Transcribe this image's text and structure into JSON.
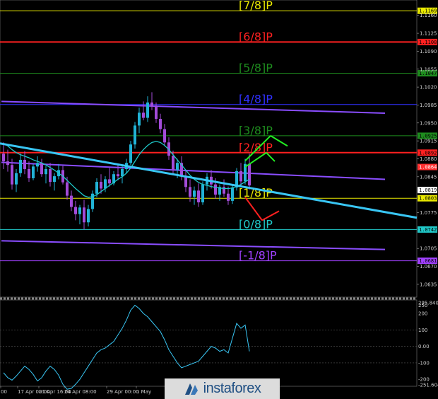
{
  "chart_data": {
    "type": "candlestick",
    "instrument_hint": "EUR/USD 4H",
    "price_axis": {
      "range": [
        1.061,
        1.119
      ],
      "ticks": [
        "1.1160",
        "1.1125",
        "1.1090",
        "1.1055",
        "1.1020",
        "1.0985",
        "1.0950",
        "1.0915",
        "1.0880",
        "1.0845",
        "1.0775",
        "1.0705",
        "1.0670",
        "1.0635"
      ]
    },
    "murray_levels": [
      {
        "label": "[7/8]P",
        "price": 1.1169,
        "tag": "1.1169",
        "color": "#e8e800"
      },
      {
        "label": "[6/8]P",
        "price": 1.1108,
        "tag": "1.1108",
        "color": "#ff2020"
      },
      {
        "label": "[5/8]P",
        "price": 1.1047,
        "tag": "1.1047",
        "color": "#1e8c1e"
      },
      {
        "label": "[4/8]P",
        "price": 1.0986,
        "tag": "",
        "color": "#3030ff"
      },
      {
        "label": "[3/8]P",
        "price": 1.0925,
        "tag": "1.0925",
        "color": "#1e8c1e"
      },
      {
        "label": "[2/8]P",
        "price": 1.0892,
        "tag": "1.0892",
        "color": "#ff2020"
      },
      {
        "label": "[1/8]P",
        "price": 1.0803,
        "tag": "1.0803",
        "color": "#e8e800"
      },
      {
        "label": "[0/8]P",
        "price": 1.0742,
        "tag": "1.0742",
        "color": "#20c8c8"
      },
      {
        "label": "[-1/8]P",
        "price": 1.0681,
        "tag": "1.0681",
        "color": "#a040ff"
      }
    ],
    "price_tags": [
      {
        "value": "1.0864",
        "price": 1.0864,
        "color": "#ff3030"
      },
      {
        "value": "1.0819",
        "price": 1.0819,
        "color": "#ffffff"
      }
    ],
    "time_axis": {
      "labels": [
        "00",
        "17 Apr 00:00",
        "21 Apr 16:00",
        "24 Apr 08:00",
        "29 Apr 00:00",
        "1 May"
      ]
    },
    "candles": [
      [
        1.089,
        1.0912,
        1.086,
        1.0875
      ],
      [
        1.0875,
        1.0898,
        1.0855,
        1.0868
      ],
      [
        1.0868,
        1.088,
        1.082,
        1.083
      ],
      [
        1.083,
        1.086,
        1.0815,
        1.0852
      ],
      [
        1.0852,
        1.089,
        1.0845,
        1.0878
      ],
      [
        1.0878,
        1.0895,
        1.085,
        1.086
      ],
      [
        1.086,
        1.0875,
        1.0835,
        1.0842
      ],
      [
        1.0842,
        1.087,
        1.0838,
        1.0865
      ],
      [
        1.0865,
        1.0885,
        1.0855,
        1.0872
      ],
      [
        1.0872,
        1.088,
        1.0845,
        1.085
      ],
      [
        1.085,
        1.0866,
        1.0832,
        1.086
      ],
      [
        1.086,
        1.0872,
        1.0826,
        1.0835
      ],
      [
        1.0835,
        1.0852,
        1.0818,
        1.0846
      ],
      [
        1.0846,
        1.087,
        1.084,
        1.0858
      ],
      [
        1.0858,
        1.0866,
        1.083,
        1.0834
      ],
      [
        1.0834,
        1.0845,
        1.08,
        1.0808
      ],
      [
        1.0808,
        1.0818,
        1.0778,
        1.0786
      ],
      [
        1.0786,
        1.0798,
        1.076,
        1.0772
      ],
      [
        1.0772,
        1.079,
        1.0752,
        1.0785
      ],
      [
        1.0785,
        1.08,
        1.0742,
        1.0756
      ],
      [
        1.0756,
        1.079,
        1.0748,
        1.0782
      ],
      [
        1.0782,
        1.0818,
        1.0776,
        1.0812
      ],
      [
        1.0812,
        1.0842,
        1.0805,
        1.0835
      ],
      [
        1.0835,
        1.085,
        1.0812,
        1.0822
      ],
      [
        1.0822,
        1.0846,
        1.0815,
        1.084
      ],
      [
        1.084,
        1.0862,
        1.0826,
        1.0832
      ],
      [
        1.0832,
        1.0856,
        1.0828,
        1.085
      ],
      [
        1.085,
        1.087,
        1.0838,
        1.0846
      ],
      [
        1.0846,
        1.0866,
        1.0832,
        1.086
      ],
      [
        1.086,
        1.088,
        1.0852,
        1.0872
      ],
      [
        1.0872,
        1.0915,
        1.0868,
        1.0908
      ],
      [
        1.0908,
        1.0952,
        1.09,
        1.0945
      ],
      [
        1.0945,
        1.098,
        1.093,
        1.097
      ],
      [
        1.097,
        1.0992,
        1.0955,
        1.096
      ],
      [
        1.096,
        1.1002,
        1.0952,
        1.099
      ],
      [
        1.099,
        1.101,
        1.0975,
        1.0982
      ],
      [
        1.0982,
        1.099,
        1.095,
        1.0958
      ],
      [
        1.0958,
        1.0968,
        1.093,
        1.0938
      ],
      [
        1.0938,
        1.0948,
        1.0905,
        1.0912
      ],
      [
        1.0912,
        1.0922,
        1.0878,
        1.0886
      ],
      [
        1.0886,
        1.0896,
        1.085,
        1.0858
      ],
      [
        1.0858,
        1.088,
        1.0842,
        1.0872
      ],
      [
        1.0872,
        1.0885,
        1.0838,
        1.0846
      ],
      [
        1.0846,
        1.0858,
        1.0815,
        1.0825
      ],
      [
        1.0825,
        1.084,
        1.0796,
        1.0806
      ],
      [
        1.0806,
        1.0826,
        1.079,
        1.0818
      ],
      [
        1.0818,
        1.0832,
        1.0786,
        1.0795
      ],
      [
        1.0795,
        1.0836,
        1.079,
        1.083
      ],
      [
        1.083,
        1.0852,
        1.0818,
        1.0845
      ],
      [
        1.0845,
        1.0858,
        1.0822,
        1.083
      ],
      [
        1.083,
        1.0842,
        1.0802,
        1.081
      ],
      [
        1.081,
        1.083,
        1.0798,
        1.0825
      ],
      [
        1.0825,
        1.084,
        1.0806,
        1.0812
      ],
      [
        1.0812,
        1.0826,
        1.079,
        1.0798
      ],
      [
        1.0798,
        1.083,
        1.0792,
        1.0824
      ],
      [
        1.0824,
        1.0862,
        1.0818,
        1.0856
      ],
      [
        1.0856,
        1.0872,
        1.0828,
        1.0836
      ],
      [
        1.0836,
        1.088,
        1.083,
        1.087
      ],
      [
        1.087,
        1.089,
        1.082,
        1.0828
      ]
    ],
    "moving_average": [
      1.091,
      1.0905,
      1.0898,
      1.0892,
      1.0888,
      1.0885,
      1.0882,
      1.0878,
      1.0875,
      1.0872,
      1.0868,
      1.0863,
      1.0858,
      1.0852,
      1.0846,
      1.0838,
      1.083,
      1.0822,
      1.0815,
      1.0808,
      1.0805,
      1.0806,
      1.081,
      1.0816,
      1.0822,
      1.0828,
      1.0834,
      1.084,
      1.0845,
      1.0852,
      1.0862,
      1.0875,
      1.0888,
      1.0898,
      1.0906,
      1.0912,
      1.0914,
      1.0912,
      1.0906,
      1.0898,
      1.0888,
      1.0878,
      1.0868,
      1.0858,
      1.0848,
      1.084,
      1.0834,
      1.083,
      1.0828,
      1.0826,
      1.0824,
      1.0823,
      1.0822,
      1.0822,
      1.0823,
      1.0826,
      1.083,
      1.0835,
      1.084
    ],
    "trendline": {
      "from": [
        0,
        1.091
      ],
      "to": [
        90,
        1.0765
      ],
      "color": "#39c6f4"
    },
    "channel_lines": [
      {
        "from": [
          0,
          1.0992
        ],
        "to": [
          90,
          1.0969
        ],
        "color": "#8a4dff"
      },
      {
        "from": [
          0,
          1.0873
        ],
        "to": [
          90,
          1.084
        ],
        "color": "#8a4dff"
      },
      {
        "from": [
          0,
          1.072
        ],
        "to": [
          90,
          1.0703
        ],
        "color": "#8a4dff"
      }
    ],
    "arrows": [
      {
        "from": [
          57,
          1.0864
        ],
        "to": [
          62,
          1.0892
        ],
        "color": "#22ee22"
      },
      {
        "from": [
          62,
          1.0892
        ],
        "to": [
          64,
          1.0875
        ],
        "color": "#22ee22"
      },
      {
        "from": [
          57,
          1.0876
        ],
        "to": [
          63,
          1.0925
        ],
        "color": "#22ee22"
      },
      {
        "from": [
          63,
          1.0925
        ],
        "to": [
          67,
          1.0905
        ],
        "color": "#22ee22"
      },
      {
        "from": [
          57,
          1.0805
        ],
        "to": [
          61,
          1.076
        ],
        "color": "#ff2020"
      },
      {
        "from": [
          61,
          1.076
        ],
        "to": [
          65,
          1.0778
        ],
        "color": "#ff2020"
      }
    ],
    "oscillator": {
      "range": [
        -225,
        265
      ],
      "ticks": [
        "295.8403",
        "250",
        "200",
        "100",
        "0.00",
        "-100",
        "-200",
        "-251.6046"
      ],
      "values": [
        -160,
        -190,
        -205,
        -180,
        -150,
        -120,
        -140,
        -170,
        -210,
        -190,
        -150,
        -120,
        -140,
        -175,
        -230,
        -260,
        -255,
        -230,
        -200,
        -160,
        -120,
        -80,
        -40,
        -20,
        -10,
        10,
        30,
        70,
        110,
        160,
        220,
        250,
        230,
        200,
        180,
        150,
        120,
        90,
        40,
        -20,
        -60,
        -100,
        -130,
        -120,
        -110,
        -100,
        -90,
        -60,
        -30,
        0,
        -10,
        -30,
        -20,
        -40,
        50,
        140,
        110,
        130,
        -30
      ],
      "color": "#39c6f4"
    }
  },
  "brand": {
    "name": "instaforex"
  }
}
